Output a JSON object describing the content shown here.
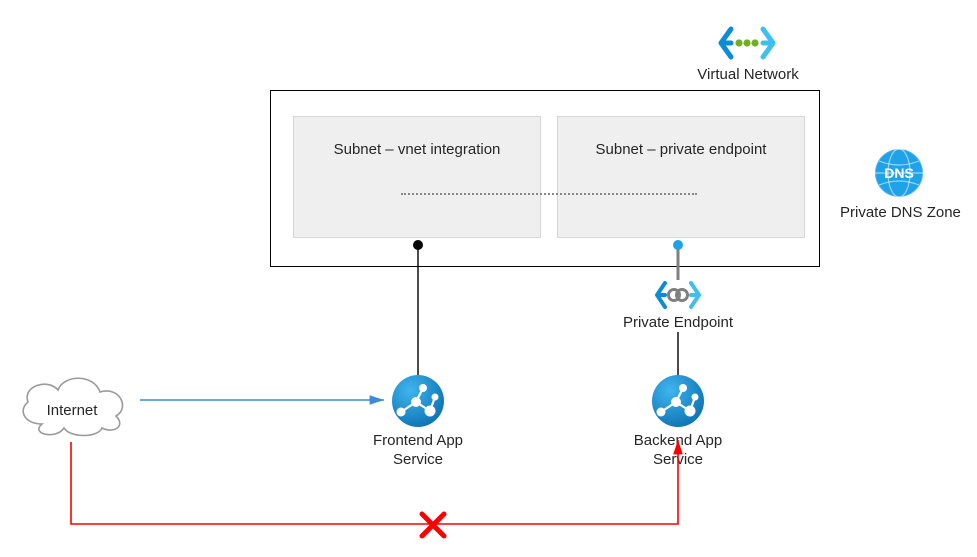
{
  "diagram": {
    "vnet_label": "Virtual Network",
    "subnet1_label": "Subnet – vnet integration",
    "subnet2_label": "Subnet – private endpoint",
    "private_endpoint_label": "Private Endpoint",
    "private_dns_label": "Private DNS Zone",
    "frontend_label": "Frontend App\nService",
    "backend_label": "Backend App\nService",
    "internet_label": "Internet",
    "colors": {
      "azure_blue": "#0b8cd4",
      "azure_accent": "#1fa2e8",
      "vnet_green": "#70af1e",
      "allow_blue": "#3a8ad6",
      "deny_red": "#ff0000"
    }
  }
}
